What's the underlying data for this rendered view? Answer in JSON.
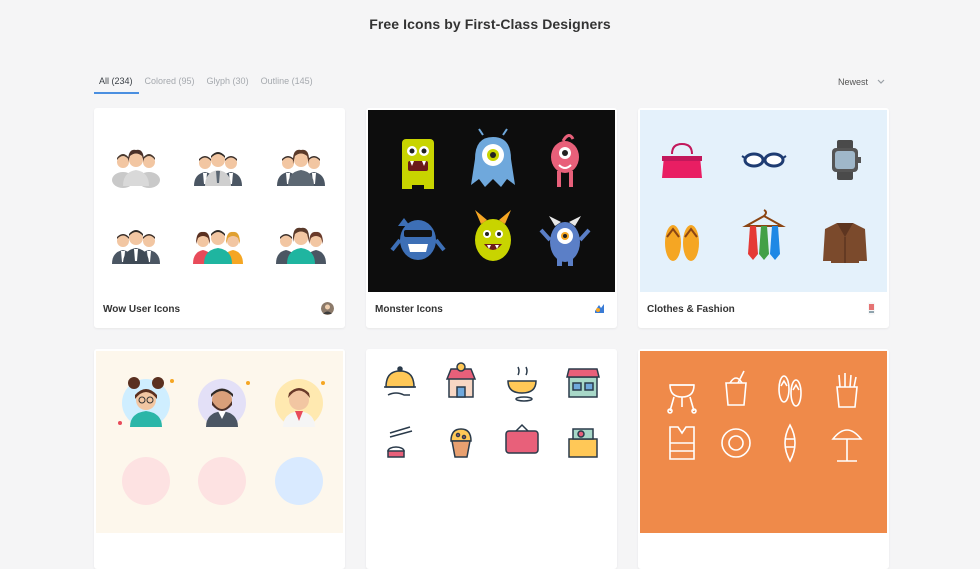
{
  "page": {
    "title": "Free Icons by First-Class Designers"
  },
  "filters": {
    "tabs": [
      {
        "label": "All (234)",
        "active": true
      },
      {
        "label": "Colored (95)",
        "active": false
      },
      {
        "label": "Glyph (30)",
        "active": false
      },
      {
        "label": "Outline (145)",
        "active": false
      }
    ],
    "sort": {
      "label": "Newest",
      "icon": "chevron-down-icon"
    }
  },
  "cards": [
    {
      "name": "Wow User Icons",
      "thumb_bg": "#ffffff",
      "author_icon": "author-avatar-icon"
    },
    {
      "name": "Monster Icons",
      "thumb_bg": "#0d0d0d",
      "author_icon": "author-avatar-icon"
    },
    {
      "name": "Clothes & Fashion",
      "thumb_bg": "#e4f1fb",
      "author_icon": "author-avatar-icon"
    },
    {
      "name": "",
      "thumb_bg": "#fdf7ec"
    },
    {
      "name": "",
      "thumb_bg": "#ffffff"
    },
    {
      "name": "",
      "thumb_bg": "#ef8a4a"
    }
  ],
  "colors": {
    "accent": "#4a8fe0",
    "page_bg": "#f5f5f6"
  }
}
